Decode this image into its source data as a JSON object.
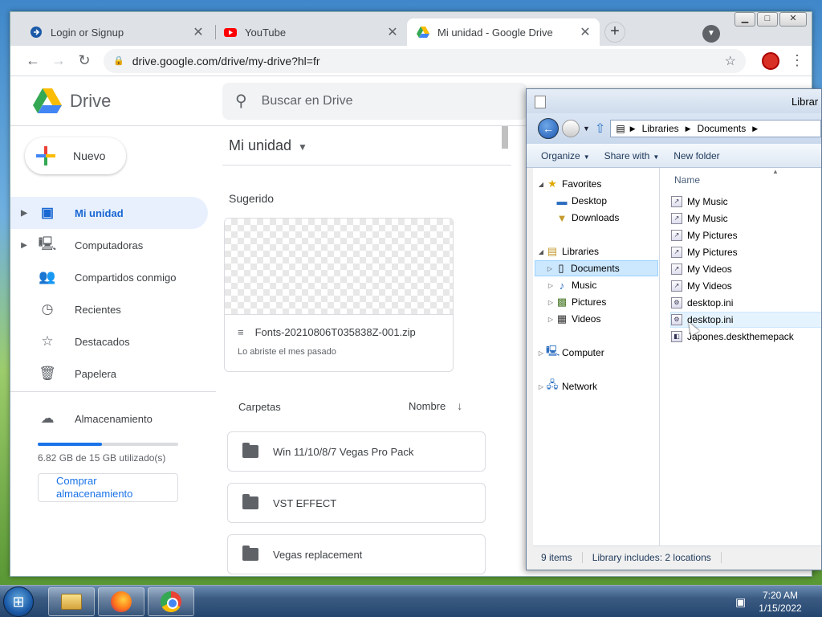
{
  "browser": {
    "tabs": [
      {
        "label": "Login or Signup",
        "icon": "login-favicon",
        "active": false
      },
      {
        "label": "YouTube",
        "icon": "youtube-favicon",
        "active": false
      },
      {
        "label": "Mi unidad - Google Drive",
        "icon": "drive-favicon",
        "active": true
      }
    ],
    "close_glyph": "✕",
    "new_tab_glyph": "+",
    "url": "drive.google.com/drive/my-drive?hl=fr",
    "window_controls": {
      "minimize": "▁",
      "maximize": "□",
      "close": "✕"
    }
  },
  "drive": {
    "logo_text": "Drive",
    "search_placeholder": "Buscar en Drive",
    "new_button": "Nuevo",
    "nav": [
      {
        "label": "Mi unidad",
        "icon": "my-drive-icon",
        "active": true,
        "expandable": true
      },
      {
        "label": "Computadoras",
        "icon": "computers-icon",
        "active": false,
        "expandable": true
      },
      {
        "label": "Compartidos conmigo",
        "icon": "shared-icon",
        "active": false,
        "expandable": false
      },
      {
        "label": "Recientes",
        "icon": "recent-icon",
        "active": false,
        "expandable": false
      },
      {
        "label": "Destacados",
        "icon": "star-icon",
        "active": false,
        "expandable": false
      },
      {
        "label": "Papelera",
        "icon": "trash-icon",
        "active": false,
        "expandable": false
      }
    ],
    "storage": {
      "label": "Almacenamiento",
      "used_text": "6.82 GB de 15 GB utilizado(s)",
      "used_fraction": 0.455,
      "buy_label": "Comprar almacenamiento"
    },
    "main": {
      "title": "Mi unidad",
      "suggested_label": "Sugerido",
      "suggested_file": {
        "name": "Fonts-20210806T035838Z-001.zip",
        "subtitle": "Lo abriste el mes pasado"
      },
      "folders_label": "Carpetas",
      "sort_label": "Nombre",
      "folders": [
        "Win 11/10/8/7 Vegas Pro Pack",
        "VST EFFECT",
        "Vegas replacement"
      ]
    },
    "colors": {
      "accent": "#1a73e8",
      "active_bg": "#e8f0fe"
    }
  },
  "explorer": {
    "title": "Librar",
    "breadcrumb": [
      "Libraries",
      "Documents"
    ],
    "commands": [
      {
        "label": "Organize",
        "dropdown": true
      },
      {
        "label": "Share with",
        "dropdown": true
      },
      {
        "label": "New folder",
        "dropdown": false
      }
    ],
    "tree": [
      {
        "label": "Favorites",
        "level": 0,
        "icon": "favorites-star-icon",
        "expanded": true,
        "selected": false
      },
      {
        "label": "Desktop",
        "level": 1,
        "icon": "desktop-icon",
        "expanded": false,
        "selected": false
      },
      {
        "label": "Downloads",
        "level": 1,
        "icon": "downloads-icon",
        "expanded": false,
        "selected": false
      },
      {
        "label": "Libraries",
        "level": 0,
        "icon": "libraries-icon",
        "expanded": true,
        "selected": false
      },
      {
        "label": "Documents",
        "level": 1,
        "icon": "documents-icon",
        "expanded": false,
        "selected": true
      },
      {
        "label": "Music",
        "level": 1,
        "icon": "music-icon",
        "expanded": false,
        "selected": false
      },
      {
        "label": "Pictures",
        "level": 1,
        "icon": "pictures-icon",
        "expanded": false,
        "selected": false
      },
      {
        "label": "Videos",
        "level": 1,
        "icon": "videos-icon",
        "expanded": false,
        "selected": false
      },
      {
        "label": "Computer",
        "level": 0,
        "icon": "computer-icon",
        "expanded": false,
        "selected": false
      },
      {
        "label": "Network",
        "level": 0,
        "icon": "network-icon",
        "expanded": false,
        "selected": false
      }
    ],
    "column_header": "Name",
    "files": [
      {
        "name": "My Music",
        "icon": "shortcut-icon"
      },
      {
        "name": "My Music",
        "icon": "shortcut-icon"
      },
      {
        "name": "My Pictures",
        "icon": "shortcut-icon"
      },
      {
        "name": "My Pictures",
        "icon": "shortcut-icon"
      },
      {
        "name": "My Videos",
        "icon": "shortcut-icon"
      },
      {
        "name": "My Videos",
        "icon": "shortcut-icon"
      },
      {
        "name": "desktop.ini",
        "icon": "settings-file-icon"
      },
      {
        "name": "desktop.ini",
        "icon": "settings-file-icon",
        "hover": true
      },
      {
        "name": "Japones.deskthemepack",
        "icon": "theme-file-icon"
      }
    ],
    "status": {
      "count": "9 items",
      "library_info": "Library includes: 2 locations"
    }
  },
  "taskbar": {
    "start_glyph": "⊞",
    "apps": [
      {
        "name": "explorer-taskbar-button",
        "icon": "folder-icon"
      },
      {
        "name": "firefox-taskbar-button",
        "icon": "firefox-icon"
      },
      {
        "name": "chrome-taskbar-button",
        "icon": "chrome-icon"
      }
    ],
    "time": "7:20 AM",
    "date": "1/15/2022"
  }
}
